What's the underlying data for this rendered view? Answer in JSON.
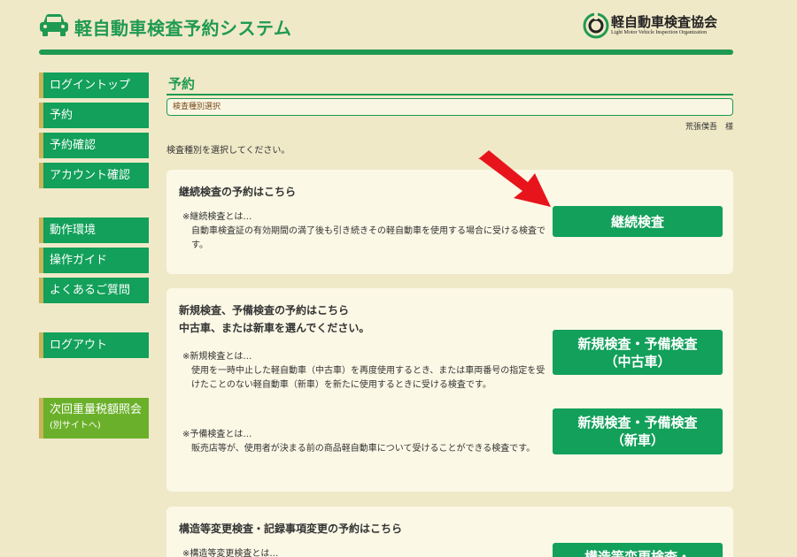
{
  "header": {
    "title": "軽自動車検査予約システム",
    "org_name": "軽自動車検査協会",
    "org_subtitle": "Light Motor Vehicle Inspection Organization",
    "logo_icon": "car-icon",
    "brand_color": "#1f9a52"
  },
  "sidebar": {
    "items": [
      {
        "label": "ログイントップ"
      },
      {
        "label": "予約"
      },
      {
        "label": "予約確認"
      },
      {
        "label": "アカウント確認"
      },
      {
        "label": "動作環境"
      },
      {
        "label": "操作ガイド"
      },
      {
        "label": "よくあるご質問"
      },
      {
        "label": "ログアウト"
      }
    ],
    "external": {
      "label": "次回重量税額照会",
      "sub": "(別サイトへ)"
    }
  },
  "main": {
    "page_title": "予約",
    "breadcrumb": "検査種別選択",
    "user_name": "荒張僕吾　様",
    "instruction": "検査種別を選択してください。",
    "cards": [
      {
        "heading": "継続検査の予約はこちら",
        "note_title": "※継続検査とは…",
        "note_desc": "自動車検査証の有効期間の満了後も引き続きその軽自動車を使用する場合に受ける検査です。",
        "button": "継続検査"
      },
      {
        "heading": "新規検査、予備検査の予約はこちら",
        "heading2": "中古車、または新車を選んでください。",
        "note1_title": "※新規検査とは…",
        "note1_desc": "使用を一時中止した軽自動車（中古車）を再度使用するとき、または車両番号の指定を受けたことのない軽自動車（新車）を新たに使用するときに受ける検査です。",
        "note2_title": "※予備検査とは…",
        "note2_desc": "販売店等が、使用者が決まる前の商品軽自動車について受けることができる検査です。",
        "button1": "新規検査・予備検査\n（中古車）",
        "button2": "新規検査・予備検査\n（新車）"
      },
      {
        "heading": "構造等変更検査・記録事項変更の予約はこちら",
        "note_title": "※構造等変更検査とは…",
        "button": "構造等変更検査・"
      }
    ]
  },
  "colors": {
    "background": "#f0e9c8",
    "button_green": "#12a05a",
    "external_green": "#6bb02a",
    "arrow_red": "#e8141c"
  }
}
